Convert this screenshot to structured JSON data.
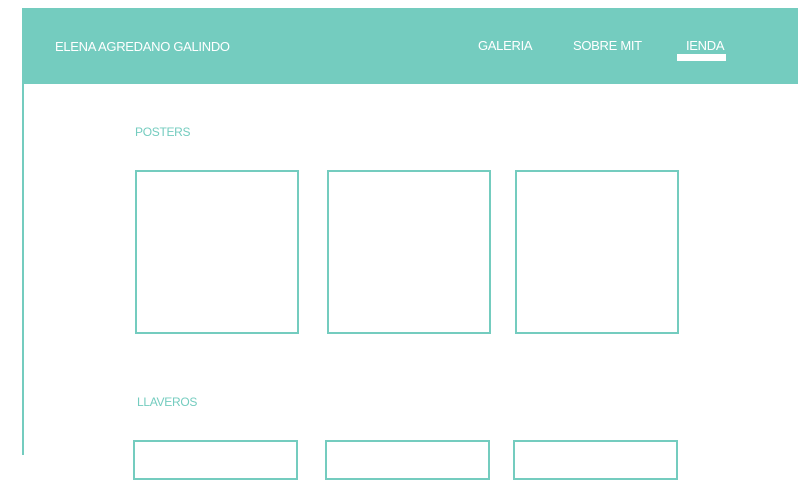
{
  "colors": {
    "accent": "#74ccbf",
    "background": "#ffffff",
    "header_text": "#ffffff"
  },
  "header": {
    "site_title": "ELENA AGREDANO GALINDO",
    "nav": [
      {
        "label": "GALERIA"
      },
      {
        "label": "SOBRE MIT"
      },
      {
        "label": "IENDA",
        "active": true
      }
    ]
  },
  "sections": [
    {
      "title": "POSTERS",
      "item_count": 3
    },
    {
      "title": "LLAVEROS",
      "item_count": 3
    }
  ]
}
